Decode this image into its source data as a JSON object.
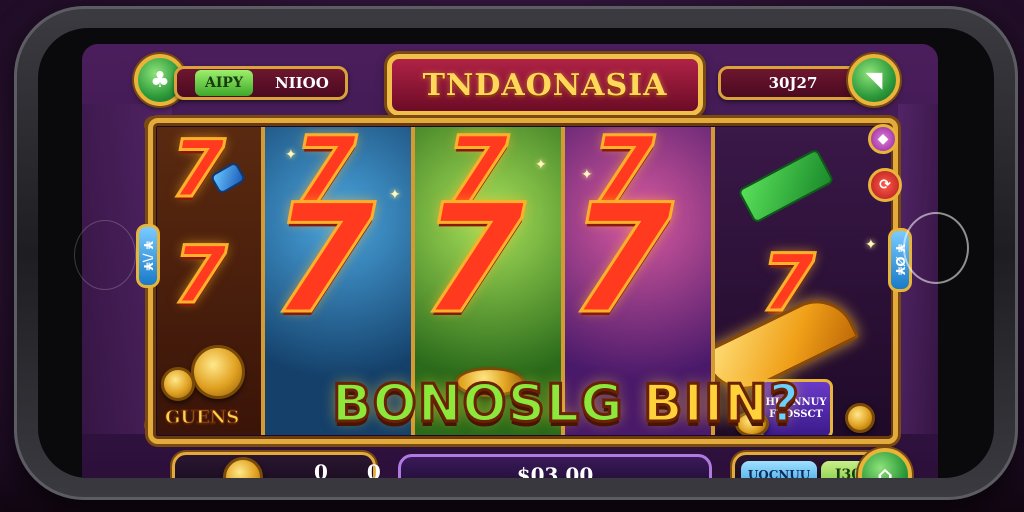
{
  "header": {
    "title": "TNDAONASIA",
    "left_tag": "AIPY",
    "left_value": "NIIOO",
    "right_value": "30J27",
    "left_icon": "clover-icon",
    "right_icon": "sound-icon"
  },
  "reels": {
    "symbol": "7",
    "left_label": "GUENS",
    "chest_label": "HUONNUY FROSSCT"
  },
  "banner": {
    "part1": "BONOSLG",
    "part2": "BIIN",
    "part3": "?"
  },
  "side": {
    "left_tab": "¥ /\\¥",
    "right_tab": "¥ Ø¥",
    "top_right_icon": "gem-icon",
    "mid_right_icon": "spin-icon"
  },
  "bottom": {
    "balance": "0 0",
    "win": "$03.00",
    "bet_label": "UOCNUU",
    "bet_value": "I30",
    "home_icon": "home-icon"
  },
  "colors": {
    "gold": "#e2ab3c",
    "seven_red": "#ff3a1e",
    "green_button": "#2c9a3a",
    "title_red": "#b02246"
  }
}
